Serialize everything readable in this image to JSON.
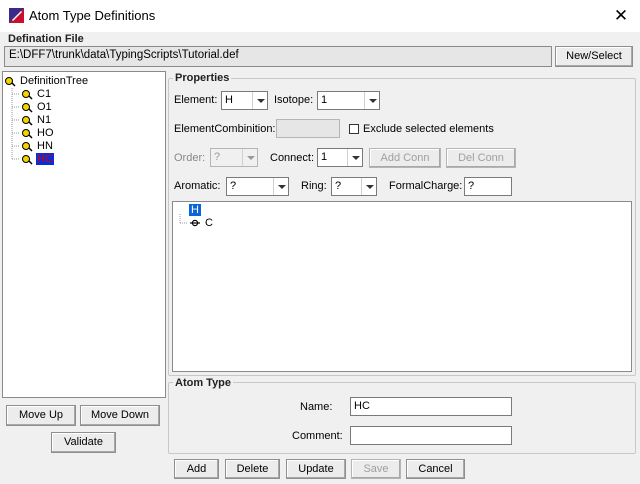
{
  "window": {
    "title": "Atom Type Definitions",
    "close_glyph": "✕"
  },
  "definition_file": {
    "label": "Defination File",
    "path": "E:\\DFF7\\trunk\\data\\TypingScripts\\Tutorial.def",
    "button": "New/Select"
  },
  "tree": {
    "root": "DefinitionTree",
    "items": [
      "C1",
      "O1",
      "N1",
      "HO",
      "HN",
      "HC"
    ],
    "selected": "HC"
  },
  "properties": {
    "label": "Properties",
    "element_label": "Element:",
    "element_value": "H",
    "isotope_label": "Isotope:",
    "isotope_value": "1",
    "element_combination_label": "ElementCombinition:",
    "element_combination_value": "",
    "exclude_label": "Exclude selected elements",
    "order_label": "Order:",
    "order_value": "?",
    "connect_label": "Connect:",
    "connect_value": "1",
    "add_conn": "Add Conn",
    "del_conn": "Del Conn",
    "aromatic_label": "Aromatic:",
    "aromatic_value": "?",
    "ring_label": "Ring:",
    "ring_value": "?",
    "formal_charge_label": "FormalCharge:",
    "formal_charge_value": "?"
  },
  "structure": {
    "root_atom": "H",
    "child_atom": "C"
  },
  "atom_type": {
    "label": "Atom Type",
    "name_label": "Name:",
    "name_value": "HC",
    "comment_label": "Comment:",
    "comment_value": ""
  },
  "left_buttons": {
    "move_up": "Move Up",
    "move_down": "Move Down",
    "validate": "Validate"
  },
  "bottom_buttons": {
    "add": "Add",
    "delete": "Delete",
    "update": "Update",
    "save": "Save",
    "cancel": "Cancel"
  },
  "icons": {
    "app": "app-logo-icon",
    "tree_node": "atom-node-icon",
    "close": "close-icon"
  },
  "colors": {
    "selection_bg": "#0a2dd6",
    "selection_text": "#d80000",
    "node_icon": "#f2d400"
  }
}
